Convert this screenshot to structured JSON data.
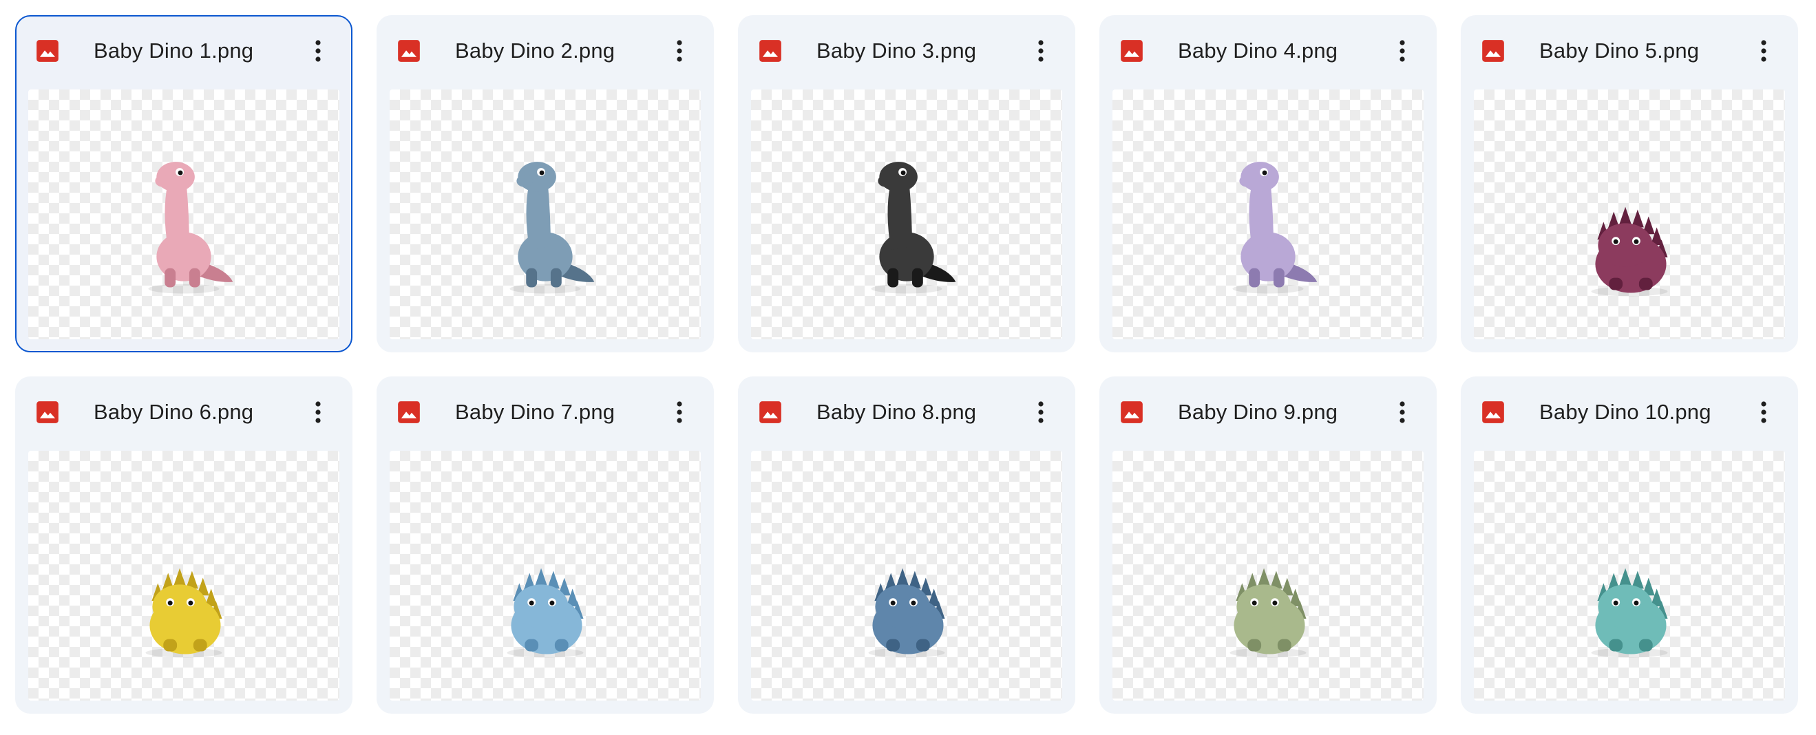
{
  "files": [
    {
      "name": "Baby Dino 1.png",
      "selected": true,
      "dino": "long-neck",
      "color": "#e9a9b7",
      "shade": "#c97f90"
    },
    {
      "name": "Baby Dino 2.png",
      "selected": false,
      "dino": "long-neck",
      "color": "#7e9db5",
      "shade": "#56738b"
    },
    {
      "name": "Baby Dino 3.png",
      "selected": false,
      "dino": "long-neck",
      "color": "#3a3a3a",
      "shade": "#1a1a1a"
    },
    {
      "name": "Baby Dino 4.png",
      "selected": false,
      "dino": "long-neck",
      "color": "#b9a8d6",
      "shade": "#8d7bb0"
    },
    {
      "name": "Baby Dino 5.png",
      "selected": false,
      "dino": "spiky",
      "color": "#8c3b5e",
      "shade": "#62203e"
    },
    {
      "name": "Baby Dino 6.png",
      "selected": false,
      "dino": "spiky",
      "color": "#e8cc34",
      "shade": "#c2a21a"
    },
    {
      "name": "Baby Dino 7.png",
      "selected": false,
      "dino": "spiky",
      "color": "#86b7d8",
      "shade": "#5a8fb6"
    },
    {
      "name": "Baby Dino 8.png",
      "selected": false,
      "dino": "spiky",
      "color": "#5f86ab",
      "shade": "#3f6385"
    },
    {
      "name": "Baby Dino 9.png",
      "selected": false,
      "dino": "spiky",
      "color": "#a9b98c",
      "shade": "#7f9066"
    },
    {
      "name": "Baby Dino 10.png",
      "selected": false,
      "dino": "spiky",
      "color": "#6fbcb8",
      "shade": "#45918d"
    }
  ],
  "icons": {
    "file_type": "image-file-icon",
    "more": "more-vert-icon"
  },
  "colors": {
    "file_icon": "#d93025",
    "selected_border": "#0b57d0",
    "card_bg": "#f0f4f9"
  }
}
